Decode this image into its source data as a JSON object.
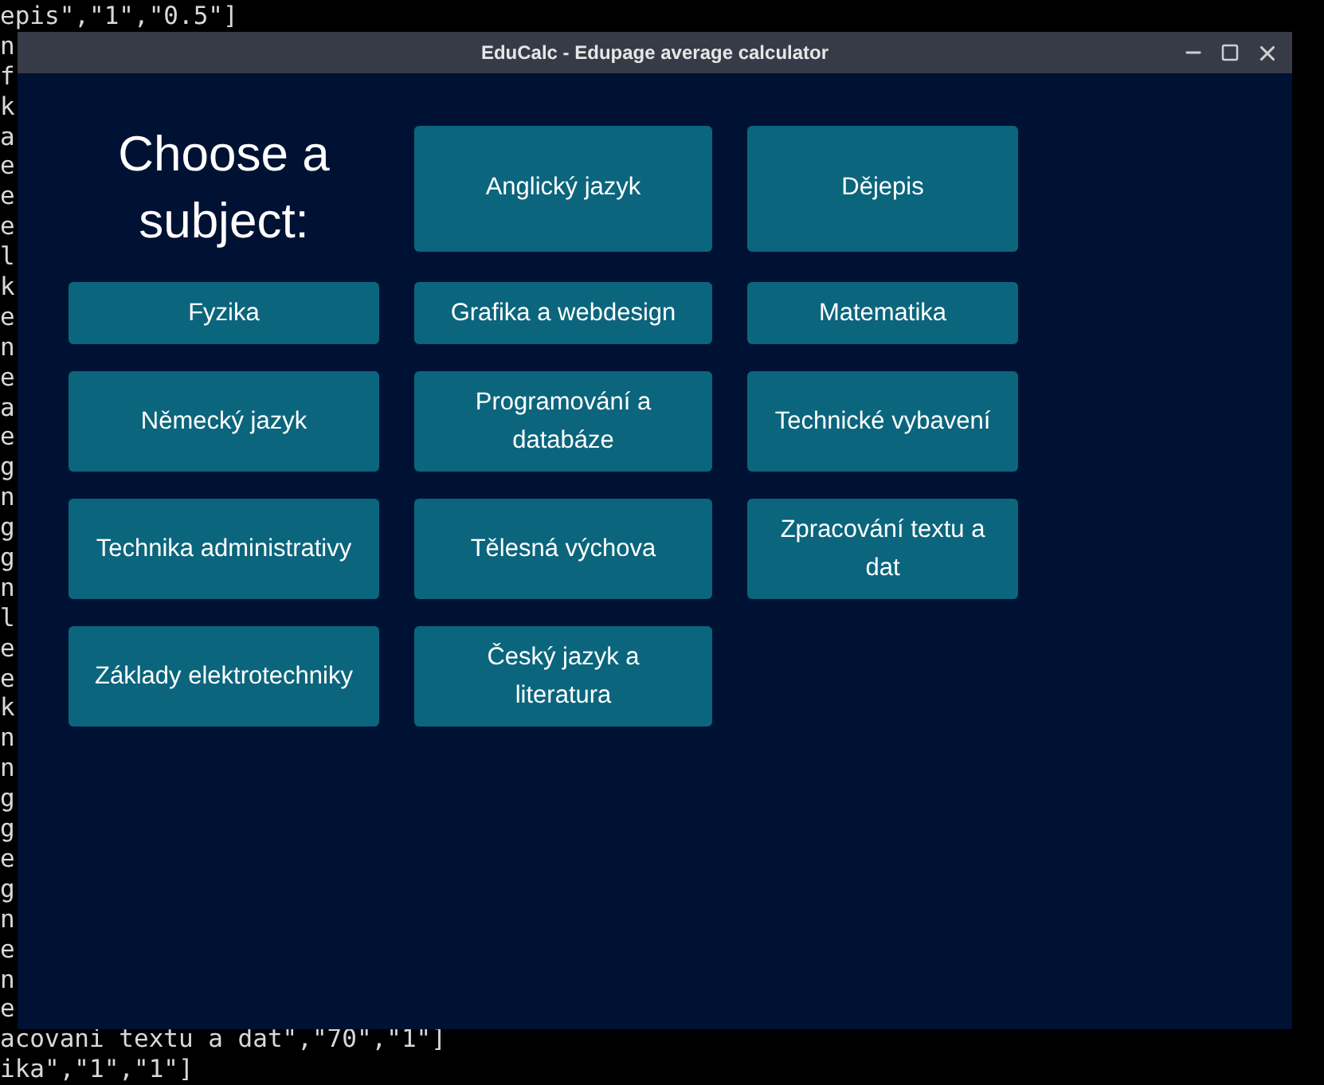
{
  "terminal": {
    "top_lines": [
      "epis\",\"1\",\"0.5\"]",
      "n",
      "f",
      "k",
      "a",
      "e",
      "e",
      "e",
      "l",
      "k",
      "e",
      "n",
      "e",
      "a",
      "e",
      "g",
      "n",
      "g",
      "g",
      "n",
      "l",
      "e",
      "e",
      "k",
      "n",
      "n",
      "g",
      "g",
      "e",
      "g",
      "n",
      "e",
      "n",
      "e"
    ],
    "bottom_lines": [
      "acovani textu a dat\",\"70\",\"1\"]",
      "ika\",\"1\",\"1\"]"
    ]
  },
  "window": {
    "title": "EduCalc - Edupage average calculator"
  },
  "heading": "Choose a subject:",
  "subjects": [
    "Anglický jazyk",
    "Dějepis",
    "Fyzika",
    "Grafika a webdesign",
    "Matematika",
    "Německý jazyk",
    "Programování a databáze",
    "Technické vybavení",
    "Technika administrativy",
    "Tělesná výchova",
    "Zpracování textu a dat",
    "Základy elektrotechniky",
    "Český jazyk a literatura"
  ]
}
